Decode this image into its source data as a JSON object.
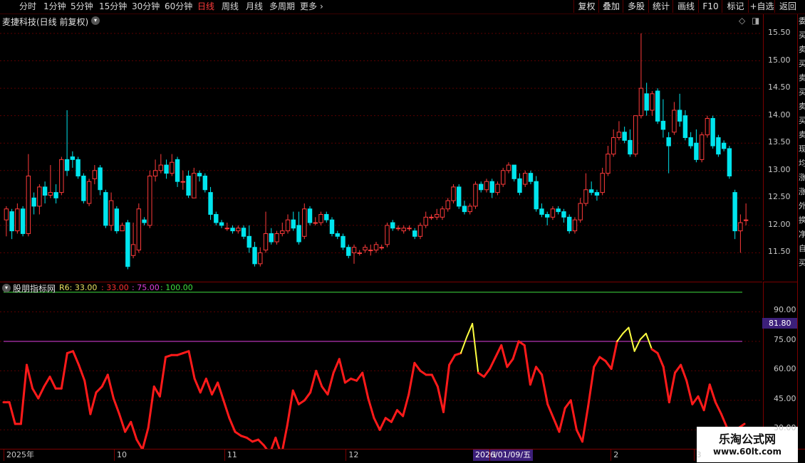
{
  "toolbar": {
    "periods": [
      "分时",
      "1分钟",
      "5分钟",
      "15分钟",
      "30分钟",
      "60分钟",
      "日线",
      "周线",
      "月线",
      "多周期",
      "更多"
    ],
    "active_period": "日线",
    "buttons": [
      "复权",
      "叠加",
      "多股",
      "统计",
      "画线",
      "F10",
      "标记",
      "+自选",
      "返回"
    ]
  },
  "main_chart": {
    "title": "麦捷科技(日线 前复权)",
    "price_ticks": [
      "15.50",
      "15.00",
      "14.50",
      "14.00",
      "13.50",
      "13.00",
      "12.50",
      "12.00",
      "11.50"
    ],
    "price_tick_values": [
      15.5,
      15.0,
      14.5,
      14.0,
      13.5,
      13.0,
      12.5,
      12.0,
      11.5
    ],
    "y_range": [
      11.0,
      15.85
    ],
    "candles": [
      [
        12.1,
        12.3,
        11.8,
        12.35
      ],
      [
        12.25,
        11.9,
        11.75,
        12.3
      ],
      [
        11.9,
        12.3,
        11.85,
        12.4
      ],
      [
        12.3,
        11.85,
        11.8,
        12.35
      ],
      [
        11.85,
        12.9,
        11.8,
        13.3
      ],
      [
        12.5,
        12.35,
        12.2,
        12.6
      ],
      [
        12.35,
        12.7,
        12.2,
        12.75
      ],
      [
        12.7,
        12.55,
        12.4,
        12.8
      ],
      [
        12.55,
        12.6,
        12.5,
        13.1
      ],
      [
        12.6,
        12.5,
        12.4,
        12.75
      ],
      [
        12.6,
        13.2,
        12.55,
        13.25
      ],
      [
        13.2,
        13.0,
        12.9,
        14.1
      ],
      [
        13.25,
        13.2,
        13.05,
        13.35
      ],
      [
        13.2,
        12.9,
        12.85,
        13.25
      ],
      [
        12.9,
        12.45,
        12.4,
        12.95
      ],
      [
        12.4,
        12.8,
        12.35,
        12.85
      ],
      [
        12.85,
        13.0,
        12.75,
        13.1
      ],
      [
        13.05,
        12.65,
        12.55,
        13.1
      ],
      [
        12.6,
        12.0,
        11.95,
        12.65
      ],
      [
        12.0,
        12.45,
        11.9,
        12.6
      ],
      [
        12.3,
        11.9,
        11.85,
        12.35
      ],
      [
        11.9,
        12.0,
        11.95,
        12.05
      ],
      [
        12.05,
        11.25,
        11.2,
        12.1
      ],
      [
        11.45,
        11.65,
        11.4,
        12.05
      ],
      [
        11.55,
        12.3,
        11.5,
        12.4
      ],
      [
        12.1,
        12.05,
        12.0,
        12.15
      ],
      [
        12.0,
        12.9,
        11.95,
        13.0
      ],
      [
        12.9,
        13.0,
        12.8,
        13.2
      ],
      [
        13.0,
        13.1,
        12.95,
        13.3
      ],
      [
        13.1,
        12.95,
        12.85,
        13.2
      ],
      [
        12.95,
        13.15,
        12.9,
        13.3
      ],
      [
        13.2,
        12.8,
        12.7,
        13.25
      ],
      [
        12.8,
        12.8,
        12.65,
        13.0
      ],
      [
        12.9,
        12.55,
        12.5,
        13.0
      ],
      [
        12.5,
        12.95,
        12.5,
        13.05
      ],
      [
        12.95,
        12.9,
        12.8,
        13.0
      ],
      [
        12.9,
        12.65,
        12.6,
        12.95
      ],
      [
        12.6,
        12.2,
        12.1,
        12.7
      ],
      [
        12.2,
        12.05,
        12.0,
        12.25
      ],
      [
        12.05,
        12.0,
        11.95,
        12.1
      ],
      [
        11.95,
        11.95,
        11.9,
        12.05
      ],
      [
        11.95,
        11.9,
        11.85,
        12.0
      ],
      [
        11.9,
        11.95,
        11.85,
        12.0
      ],
      [
        11.95,
        11.8,
        11.75,
        12.0
      ],
      [
        11.8,
        11.6,
        11.5,
        12.0
      ],
      [
        11.6,
        11.3,
        11.25,
        11.7
      ],
      [
        11.3,
        11.5,
        11.25,
        11.6
      ],
      [
        11.55,
        11.85,
        11.5,
        12.25
      ],
      [
        11.85,
        11.7,
        11.65,
        11.95
      ],
      [
        11.7,
        11.85,
        11.65,
        11.9
      ],
      [
        11.85,
        11.9,
        11.8,
        12.05
      ],
      [
        11.9,
        12.1,
        11.85,
        12.2
      ],
      [
        12.1,
        11.95,
        11.9,
        12.25
      ],
      [
        12.0,
        11.7,
        11.65,
        12.25
      ],
      [
        11.8,
        12.3,
        11.75,
        12.4
      ],
      [
        12.3,
        12.05,
        12.0,
        12.35
      ],
      [
        12.05,
        12.05,
        12.0,
        12.15
      ],
      [
        12.05,
        12.2,
        12.0,
        12.25
      ],
      [
        12.2,
        12.1,
        12.05,
        12.25
      ],
      [
        12.1,
        11.85,
        11.8,
        12.15
      ],
      [
        11.85,
        11.8,
        11.75,
        11.9
      ],
      [
        11.8,
        11.6,
        11.55,
        11.85
      ],
      [
        11.6,
        11.45,
        11.4,
        11.65
      ],
      [
        11.5,
        11.6,
        11.3,
        11.65
      ],
      [
        11.5,
        11.5,
        11.45,
        11.55
      ],
      [
        11.55,
        11.6,
        11.5,
        11.65
      ],
      [
        11.55,
        11.55,
        11.45,
        11.65
      ],
      [
        11.55,
        11.65,
        11.5,
        11.7
      ],
      [
        11.6,
        11.6,
        11.55,
        11.65
      ],
      [
        11.65,
        12.0,
        11.6,
        12.05
      ],
      [
        12.05,
        11.95,
        11.9,
        12.1
      ],
      [
        11.95,
        11.95,
        11.9,
        12.0
      ],
      [
        11.9,
        11.95,
        11.85,
        12.0
      ],
      [
        11.95,
        11.95,
        11.9,
        12.0
      ],
      [
        11.9,
        11.8,
        11.75,
        11.95
      ],
      [
        11.8,
        12.0,
        11.75,
        12.05
      ],
      [
        12.0,
        12.15,
        11.95,
        12.25
      ],
      [
        12.15,
        12.15,
        12.1,
        12.2
      ],
      [
        12.15,
        12.2,
        12.1,
        12.3
      ],
      [
        12.15,
        12.3,
        12.1,
        12.35
      ],
      [
        12.3,
        12.45,
        12.25,
        12.5
      ],
      [
        12.45,
        12.7,
        12.4,
        12.75
      ],
      [
        12.7,
        12.35,
        12.3,
        12.75
      ],
      [
        12.35,
        12.25,
        12.2,
        12.45
      ],
      [
        12.25,
        12.35,
        12.2,
        12.4
      ],
      [
        12.35,
        12.75,
        12.3,
        12.8
      ],
      [
        12.75,
        12.65,
        12.6,
        12.8
      ],
      [
        12.65,
        12.8,
        12.6,
        12.85
      ],
      [
        12.8,
        12.6,
        12.5,
        12.85
      ],
      [
        12.6,
        12.75,
        12.55,
        12.8
      ],
      [
        12.75,
        13.0,
        12.7,
        13.05
      ],
      [
        13.0,
        13.1,
        12.95,
        13.15
      ],
      [
        13.1,
        12.85,
        12.8,
        13.1
      ],
      [
        12.85,
        12.6,
        12.55,
        12.95
      ],
      [
        12.75,
        12.95,
        12.7,
        13.0
      ],
      [
        12.95,
        12.8,
        12.75,
        13.0
      ],
      [
        12.8,
        12.3,
        12.25,
        12.9
      ],
      [
        12.3,
        12.2,
        12.15,
        12.4
      ],
      [
        12.2,
        12.15,
        12.0,
        12.25
      ],
      [
        12.15,
        12.3,
        12.1,
        12.35
      ],
      [
        12.3,
        12.25,
        12.2,
        12.35
      ],
      [
        12.25,
        12.15,
        12.05,
        12.3
      ],
      [
        12.15,
        11.9,
        11.85,
        12.2
      ],
      [
        11.9,
        12.1,
        11.85,
        12.15
      ],
      [
        12.1,
        12.4,
        12.05,
        12.5
      ],
      [
        12.4,
        12.65,
        12.35,
        12.95
      ],
      [
        12.65,
        12.6,
        12.55,
        12.8
      ],
      [
        12.6,
        12.55,
        12.45,
        12.65
      ],
      [
        12.6,
        12.95,
        12.55,
        13.05
      ],
      [
        12.95,
        13.3,
        12.9,
        13.45
      ],
      [
        13.3,
        13.6,
        13.25,
        13.75
      ],
      [
        13.6,
        13.7,
        13.55,
        13.9
      ],
      [
        13.7,
        13.55,
        13.5,
        13.8
      ],
      [
        13.55,
        13.3,
        13.25,
        13.75
      ],
      [
        13.3,
        14.0,
        13.25,
        14.0
      ],
      [
        14.0,
        14.5,
        13.95,
        15.5
      ],
      [
        14.4,
        14.1,
        14.0,
        14.6
      ],
      [
        14.1,
        14.4,
        14.0,
        14.45
      ],
      [
        14.45,
        13.9,
        13.85,
        14.5
      ],
      [
        13.9,
        13.75,
        13.6,
        14.3
      ],
      [
        13.6,
        13.45,
        12.95,
        13.7
      ],
      [
        13.7,
        14.1,
        13.65,
        14.25
      ],
      [
        14.1,
        13.9,
        13.8,
        14.4
      ],
      [
        14.0,
        13.6,
        13.55,
        14.1
      ],
      [
        13.6,
        13.45,
        13.4,
        13.7
      ],
      [
        13.5,
        13.2,
        13.15,
        13.75
      ],
      [
        13.2,
        13.65,
        13.15,
        13.7
      ],
      [
        13.65,
        13.95,
        13.6,
        14.0
      ],
      [
        13.95,
        13.45,
        13.4,
        14.0
      ],
      [
        13.6,
        13.3,
        13.25,
        13.65
      ],
      [
        13.5,
        13.4,
        13.35,
        13.55
      ],
      [
        13.4,
        12.9,
        12.85,
        13.45
      ],
      [
        12.6,
        11.9,
        11.75,
        12.65
      ],
      [
        11.9,
        12.05,
        11.5,
        12.2
      ],
      [
        12.1,
        12.1,
        12.0,
        12.4
      ]
    ]
  },
  "indicator": {
    "name": "股朋指标网",
    "params": [
      {
        "label": "R6: 33.00",
        "color": "#e8e060"
      },
      {
        "label": ": 33.00",
        "color": "#ff3030"
      },
      {
        "label": ": 75.00",
        "color": "#e040e0"
      },
      {
        "label": ": 100.00",
        "color": "#40e040"
      }
    ],
    "y_range": [
      20,
      105
    ],
    "y_ticks": [
      "90.00",
      "75.00",
      "60.00",
      "45.00",
      "30.00"
    ],
    "y_tick_values": [
      90,
      75,
      60,
      45,
      30
    ],
    "line100": 100,
    "line75": 75,
    "current_label": "81.80",
    "overbought_threshold": 75,
    "values": [
      44,
      44,
      33,
      33,
      63,
      51,
      46,
      52,
      57,
      51,
      51,
      69,
      70,
      63,
      55,
      38,
      49,
      52,
      58,
      46,
      38,
      29,
      34,
      25,
      20,
      31,
      52,
      47,
      67,
      68,
      68,
      69,
      70,
      56,
      49,
      56,
      48,
      54,
      45,
      36,
      29,
      27,
      26,
      24,
      25,
      22,
      18,
      26,
      17,
      32,
      50,
      43,
      45,
      49,
      60,
      52,
      48,
      59,
      66,
      54,
      56,
      55,
      59,
      46,
      36,
      30,
      36,
      34,
      40,
      37,
      48,
      64,
      60,
      58,
      58,
      52,
      39,
      63,
      68,
      69,
      77,
      84,
      59,
      57,
      61,
      67,
      73,
      62,
      66,
      75,
      73,
      53,
      62,
      58,
      43,
      36,
      29,
      41,
      45,
      30,
      24,
      42,
      62,
      67,
      65,
      61,
      75,
      79,
      82,
      70,
      76,
      79,
      71,
      69,
      62,
      44,
      59,
      63,
      55,
      43,
      47,
      40,
      53,
      44,
      38,
      31,
      27,
      31,
      33
    ]
  },
  "dates": [
    {
      "label": "2025年",
      "index": 0
    },
    {
      "label": "10",
      "index": 20
    },
    {
      "label": "11",
      "index": 40
    },
    {
      "label": "12",
      "index": 62
    },
    {
      "label": "1",
      "index": 88
    },
    {
      "label": "2",
      "index": 110
    },
    {
      "label": "3",
      "index": 125
    }
  ],
  "cursor_date": "2026/01/09/五",
  "watermark": {
    "title": "乐淘公式网",
    "url": "www.60lt.com"
  },
  "right_strip_chars": [
    "委",
    "买",
    "卖",
    "买",
    "卖",
    "买",
    "卖",
    "买",
    "卖",
    "现",
    "均",
    "涨",
    "涨",
    "外",
    "换",
    "净",
    "自",
    "买"
  ],
  "colors": {
    "up": "#ff3b3b",
    "down": "#00e5ee",
    "grid": "#5a0000",
    "axis": "#7a0000",
    "line75": "#e040e0",
    "line100": "#40e040",
    "ind_main": "#ff1a1a",
    "ind_hot": "#ffff40"
  }
}
